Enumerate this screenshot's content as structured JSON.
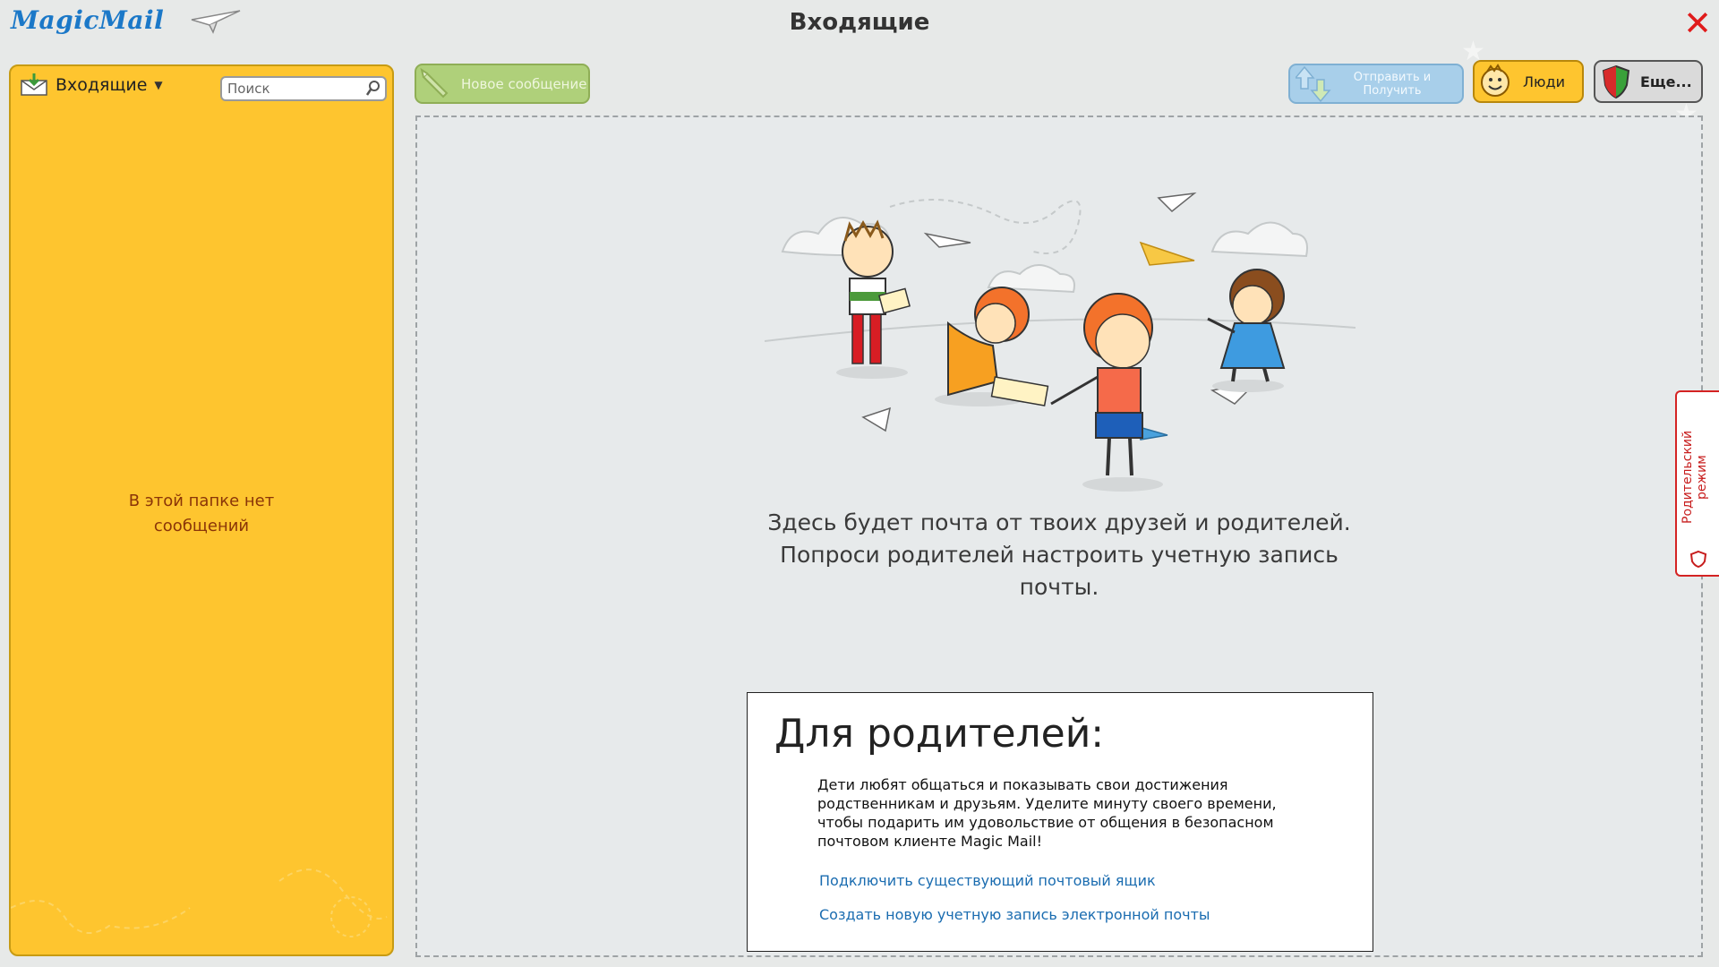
{
  "app": {
    "logo_text": "MagicMail",
    "window_title": "Входящие",
    "close_symbol": "✕"
  },
  "sidebar": {
    "folder_name": "Входящие",
    "search_placeholder": "Поиск",
    "empty_text_line1": "В этой папке нет",
    "empty_text_line2": "сообщений"
  },
  "toolbar": {
    "new_message_label": "Новое сообщение",
    "send_receive_line1": "Отправить и",
    "send_receive_line2": "Получить",
    "people_label": "Люди",
    "more_label": "Еще..."
  },
  "main": {
    "welcome_line1": "Здесь будет почта от твоих друзей и родителей.",
    "welcome_line2": "Попроси родителей настроить учетную запись",
    "welcome_line3": "почты."
  },
  "parents_card": {
    "title": "Для родителей:",
    "description": "Дети любят общаться и показывать свои достижения родственникам и друзьям. Уделите минуту своего времени, чтобы подарить им удовольствие от общения в безопасном почтовом клиенте Magic Mail!",
    "link_connect": "Подключить существующий почтовый ящик",
    "link_create": "Создать новую учетную запись электронной почты"
  },
  "parental_mode": {
    "label": "Родительский режим"
  },
  "colors": {
    "sidebar_bg": "#fec52f",
    "accent_red": "#e01b1b",
    "link_blue": "#1a6cb0",
    "new_msg_green": "#afd07a",
    "send_blue": "#a8cfea"
  }
}
